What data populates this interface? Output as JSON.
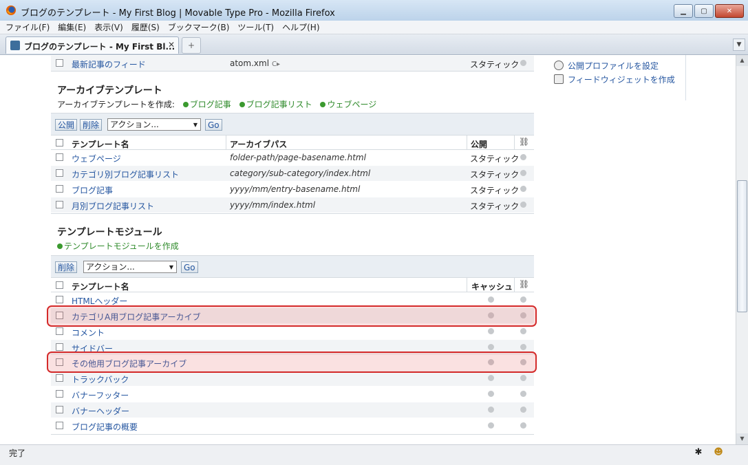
{
  "window": {
    "title": "ブログのテンプレート - My First Blog | Movable Type Pro - Mozilla Firefox",
    "controls": {
      "minimize": "▁",
      "maximize": "▢",
      "close": "✕"
    }
  },
  "menu": [
    "ファイル(F)",
    "編集(E)",
    "表示(V)",
    "履歴(S)",
    "ブックマーク(B)",
    "ツール(T)",
    "ヘルプ(H)"
  ],
  "tab": {
    "title": "ブログのテンプレート - My First Bl...",
    "close": "✕",
    "new_tab": "+"
  },
  "sidebar": {
    "items": [
      {
        "label": "公開プロファイルを設定",
        "icon": "gear-icon"
      },
      {
        "label": "フィードウィジェットを作成",
        "icon": "widget-icon"
      }
    ]
  },
  "index_tail": {
    "row": {
      "name": "最新記事のフィード",
      "path": "atom.xml",
      "publish": "スタティック"
    }
  },
  "archive": {
    "title": "アーカイブテンプレート",
    "create_label": "アーカイブテンプレートを作成:",
    "create_links": [
      "ブログ記事",
      "ブログ記事リスト",
      "ウェブページ"
    ],
    "buttons": {
      "publish": "公開",
      "delete": "削除",
      "go": "Go"
    },
    "action_placeholder": "アクション...",
    "columns": {
      "name": "テンプレート名",
      "path": "アーカイブパス",
      "publish": "公開"
    },
    "rows": [
      {
        "name": "ウェブページ",
        "path": "folder-path/page-basename.html",
        "publish": "スタティック"
      },
      {
        "name": "カテゴリ別ブログ記事リスト",
        "path": "category/sub-category/index.html",
        "publish": "スタティック"
      },
      {
        "name": "ブログ記事",
        "path": "yyyy/mm/entry-basename.html",
        "publish": "スタティック"
      },
      {
        "name": "月別ブログ記事リスト",
        "path": "yyyy/mm/index.html",
        "publish": "スタティック"
      }
    ]
  },
  "modules": {
    "title": "テンプレートモジュール",
    "create_link": "テンプレートモジュールを作成",
    "buttons": {
      "delete": "削除",
      "go": "Go"
    },
    "action_placeholder": "アクション...",
    "columns": {
      "name": "テンプレート名",
      "cache": "キャッシュ"
    },
    "rows": [
      {
        "name": "HTMLヘッダー"
      },
      {
        "name": "カテゴリA用ブログ記事アーカイブ"
      },
      {
        "name": "コメント"
      },
      {
        "name": "サイドバー"
      },
      {
        "name": "その他用ブログ記事アーカイブ"
      },
      {
        "name": "トラックバック"
      },
      {
        "name": "バナーフッター"
      },
      {
        "name": "バナーヘッダー"
      },
      {
        "name": "ブログ記事の概要"
      }
    ]
  },
  "status": {
    "text": "完了"
  },
  "colors": {
    "link": "#2556a0",
    "highlight_border": "#d42a2a",
    "plus_green": "#3b9a2f"
  }
}
